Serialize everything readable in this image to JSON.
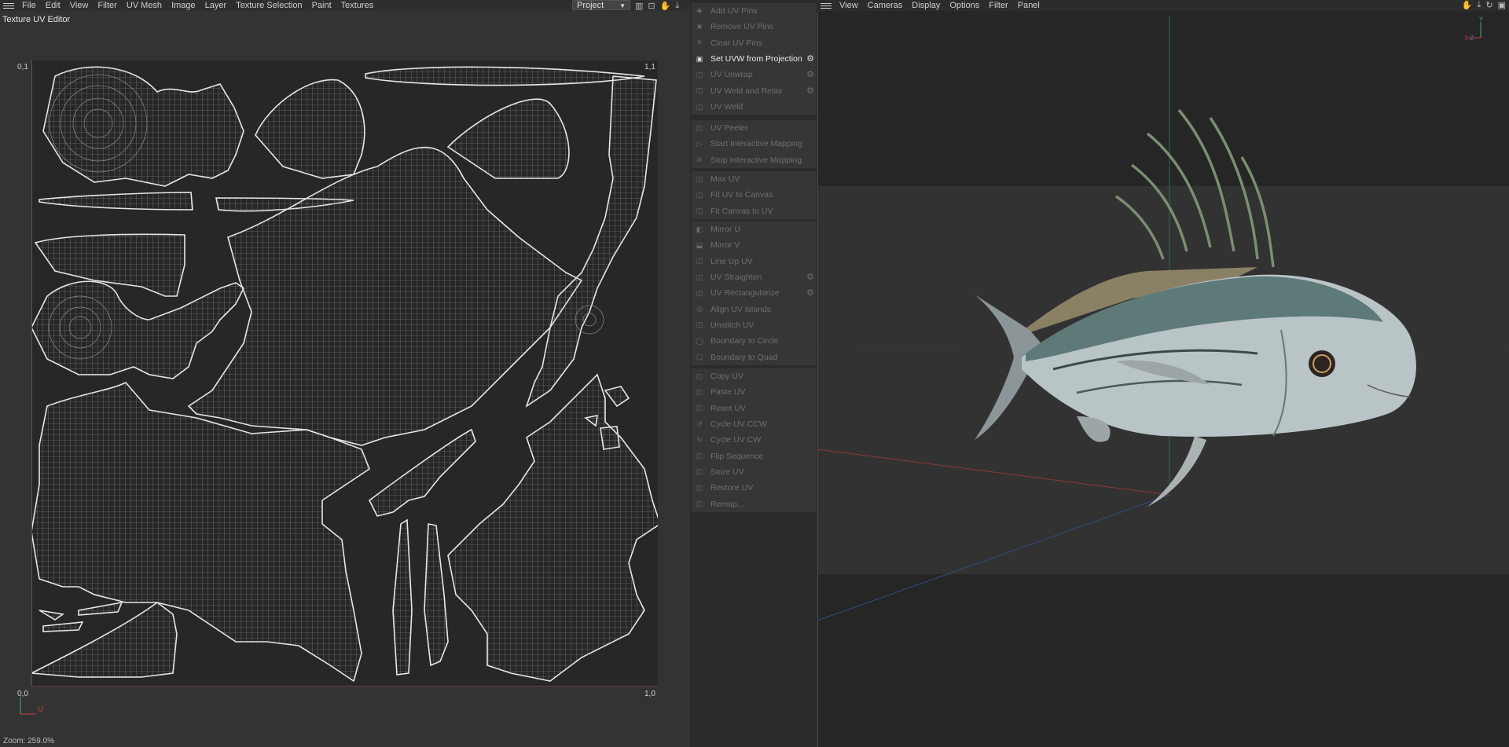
{
  "uv_editor": {
    "menu": [
      "File",
      "Edit",
      "View",
      "Filter",
      "UV Mesh",
      "Image",
      "Layer",
      "Texture Selection",
      "Paint",
      "Textures"
    ],
    "dropdown_value": "Project",
    "title": "Texture UV Editor",
    "coords": {
      "top_left": "0,1",
      "top_right": "1,1",
      "bottom_left": "0,0",
      "bottom_right": "1,0"
    },
    "axis_u_label": "U",
    "zoom_text": "Zoom: 259.0%",
    "wire_color": "#e6e6e6"
  },
  "commands": {
    "groups": [
      {
        "items": [
          {
            "label": "Add UV Pins",
            "icon": "pin-add-icon",
            "glyph": "✚",
            "enabled": false,
            "gear": false
          },
          {
            "label": "Remove UV Pins",
            "icon": "pin-remove-icon",
            "glyph": "✖",
            "enabled": false,
            "gear": false
          },
          {
            "label": "Clear UV Pins",
            "icon": "pin-clear-icon",
            "glyph": "✕",
            "enabled": false,
            "gear": false
          }
        ]
      },
      {
        "items": [
          {
            "label": "Set UVW from Projection",
            "icon": "projection-icon",
            "glyph": "▣",
            "enabled": true,
            "gear": true
          },
          {
            "label": "UV Unwrap",
            "icon": "unwrap-icon",
            "glyph": "◫",
            "enabled": false,
            "gear": true
          },
          {
            "label": "UV Weld and Relax",
            "icon": "weld-relax-icon",
            "glyph": "◫",
            "enabled": false,
            "gear": true
          },
          {
            "label": "UV Weld",
            "icon": "weld-icon",
            "glyph": "◫",
            "enabled": false,
            "gear": false
          }
        ]
      },
      {
        "items": [
          {
            "label": "UV Peeler",
            "icon": "peeler-icon",
            "glyph": "◫",
            "enabled": false,
            "gear": false
          },
          {
            "label": "Start Interactive Mapping",
            "icon": "play-icon",
            "glyph": "▷",
            "enabled": false,
            "gear": false
          },
          {
            "label": "Stop Interactive Mapping",
            "icon": "stop-icon",
            "glyph": "⊘",
            "enabled": false,
            "gear": false
          }
        ]
      },
      {
        "items": [
          {
            "label": "Max UV",
            "icon": "max-uv-icon",
            "glyph": "◫",
            "enabled": false,
            "gear": false
          },
          {
            "label": "Fit UV to Canvas",
            "icon": "fit-uv-icon",
            "glyph": "◫",
            "enabled": false,
            "gear": false
          },
          {
            "label": "Fit Canvas to UV",
            "icon": "fit-canvas-icon",
            "glyph": "◫",
            "enabled": false,
            "gear": false
          }
        ]
      },
      {
        "items": [
          {
            "label": "Mirror U",
            "icon": "mirror-u-icon",
            "glyph": "◧",
            "enabled": false,
            "gear": false
          },
          {
            "label": "Mirror V",
            "icon": "mirror-v-icon",
            "glyph": "⬓",
            "enabled": false,
            "gear": false
          },
          {
            "label": "Line Up UV",
            "icon": "line-up-icon",
            "glyph": "◫",
            "enabled": false,
            "gear": false
          },
          {
            "label": "UV Straighten",
            "icon": "straighten-icon",
            "glyph": "◫",
            "enabled": false,
            "gear": true
          },
          {
            "label": "UV Rectangularize",
            "icon": "rectangularize-icon",
            "glyph": "◫",
            "enabled": false,
            "gear": true
          },
          {
            "label": "Align UV Islands",
            "icon": "align-islands-icon",
            "glyph": "◎",
            "enabled": false,
            "gear": false
          },
          {
            "label": "Unstitch UV",
            "icon": "unstitch-icon",
            "glyph": "◫",
            "enabled": false,
            "gear": false
          },
          {
            "label": "Boundary to Circle",
            "icon": "boundary-circle-icon",
            "glyph": "◯",
            "enabled": false,
            "gear": false
          },
          {
            "label": "Boundary to Quad",
            "icon": "boundary-quad-icon",
            "glyph": "▢",
            "enabled": false,
            "gear": false
          }
        ]
      },
      {
        "items": [
          {
            "label": "Copy UV",
            "icon": "copy-icon",
            "glyph": "◫",
            "enabled": false,
            "gear": false
          },
          {
            "label": "Paste UV",
            "icon": "paste-icon",
            "glyph": "◫",
            "enabled": false,
            "gear": false
          },
          {
            "label": "Reset UV",
            "icon": "reset-icon",
            "glyph": "◫",
            "enabled": false,
            "gear": false
          },
          {
            "label": "Cycle UV CCW",
            "icon": "cycle-ccw-icon",
            "glyph": "↺",
            "enabled": false,
            "gear": false
          },
          {
            "label": "Cycle UV CW",
            "icon": "cycle-cw-icon",
            "glyph": "↻",
            "enabled": false,
            "gear": false
          },
          {
            "label": "Flip Sequence",
            "icon": "flip-icon",
            "glyph": "◫",
            "enabled": false,
            "gear": false
          },
          {
            "label": "Store UV",
            "icon": "store-icon",
            "glyph": "◫",
            "enabled": false,
            "gear": false
          },
          {
            "label": "Restore UV",
            "icon": "restore-icon",
            "glyph": "◫",
            "enabled": false,
            "gear": false
          },
          {
            "label": "Remap...",
            "icon": "remap-icon",
            "glyph": "◫",
            "enabled": false,
            "gear": false
          }
        ]
      }
    ]
  },
  "viewport": {
    "menu": [
      "View",
      "Cameras",
      "Display",
      "Options",
      "Filter",
      "Panel"
    ],
    "axis_labels": {
      "y": "Y",
      "x": "X",
      "z": "Z"
    },
    "colors": {
      "x_axis": "#c04040",
      "y_axis": "#3cb06a",
      "z_axis": "#4070c0",
      "fish_body": "#b9c4c6",
      "fish_back": "#5e7a78",
      "fin": "#b8a880"
    }
  }
}
